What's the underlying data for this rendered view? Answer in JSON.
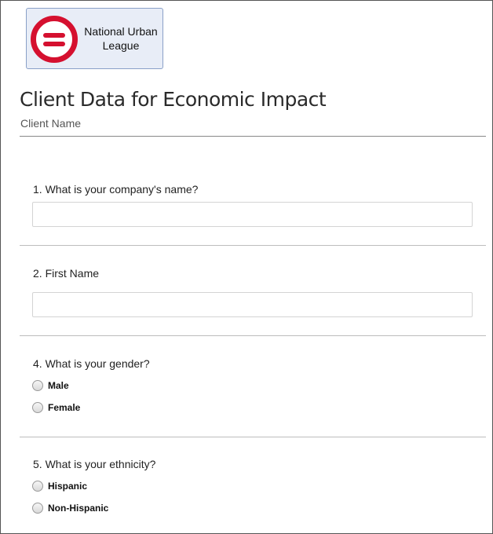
{
  "logo": {
    "org_line1": "National Urban",
    "org_line2": "League"
  },
  "form": {
    "title": "Client Data for Economic Impact",
    "subtitle": "Client Name"
  },
  "questions": [
    {
      "label": "1. What is your company's name?",
      "type": "text",
      "value": ""
    },
    {
      "label": "2. First Name",
      "type": "text",
      "value": ""
    },
    {
      "label": "4. What is your gender?",
      "type": "radio",
      "options": [
        "Male",
        "Female"
      ],
      "selected": null
    },
    {
      "label": "5. What is your ethnicity?",
      "type": "radio",
      "options": [
        "Hispanic",
        "Non-Hispanic"
      ],
      "selected": null
    }
  ],
  "colors": {
    "logo_red": "#d5102f",
    "logo_bg": "#e8edf7"
  }
}
